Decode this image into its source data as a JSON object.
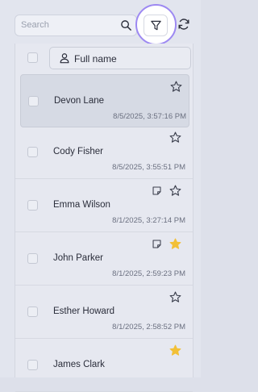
{
  "search": {
    "placeholder": "Search"
  },
  "header": {
    "column_label": "Full name"
  },
  "contacts": [
    {
      "name": "Devon Lane",
      "timestamp": "8/5/2025, 3:57:16 PM",
      "starred": false,
      "has_note": false,
      "selected": true
    },
    {
      "name": "Cody Fisher",
      "timestamp": "8/5/2025, 3:55:51 PM",
      "starred": false,
      "has_note": false,
      "selected": false
    },
    {
      "name": "Emma Wilson",
      "timestamp": "8/1/2025, 3:27:14 PM",
      "starred": false,
      "has_note": true,
      "selected": false
    },
    {
      "name": "John Parker",
      "timestamp": "8/1/2025, 2:59:23 PM",
      "starred": true,
      "has_note": true,
      "selected": false
    },
    {
      "name": "Esther Howard",
      "timestamp": "8/1/2025, 2:58:52 PM",
      "starred": false,
      "has_note": false,
      "selected": false
    },
    {
      "name": "James Clark",
      "timestamp": "",
      "starred": true,
      "has_note": false,
      "selected": false
    }
  ],
  "colors": {
    "star_filled": "#f2c037",
    "accent": "#8f7cf0",
    "background": "#e2e5ee"
  }
}
